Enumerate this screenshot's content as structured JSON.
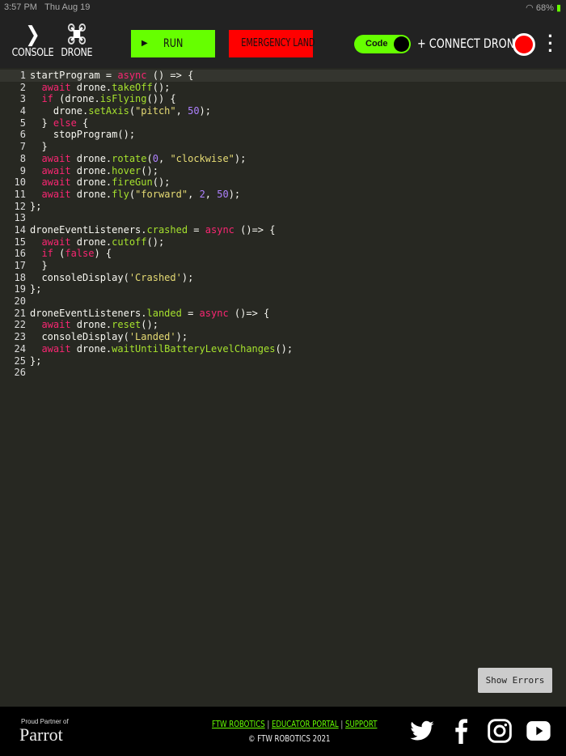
{
  "status": {
    "time": "3:57 PM",
    "date": "Thu Aug 19",
    "battery": "68%"
  },
  "toolbar": {
    "console": "CONSOLE",
    "drone": "DRONE",
    "run": "RUN",
    "emergency": "EMERGENCY LAND",
    "toggle": "Code",
    "connect": "+ CONNECT DRONE"
  },
  "editor": {
    "lines": [
      [
        [
          "c",
          "startProgram = "
        ],
        [
          "k",
          "async"
        ],
        [
          "c",
          " () => {"
        ]
      ],
      [
        [
          "c",
          "  "
        ],
        [
          "k",
          "await"
        ],
        [
          "c",
          " drone."
        ],
        [
          "f",
          "takeOff"
        ],
        [
          "c",
          "();"
        ]
      ],
      [
        [
          "c",
          "  "
        ],
        [
          "k",
          "if"
        ],
        [
          "c",
          " (drone."
        ],
        [
          "f",
          "isFlying"
        ],
        [
          "c",
          "()) {"
        ]
      ],
      [
        [
          "c",
          "    drone."
        ],
        [
          "f",
          "setAxis"
        ],
        [
          "c",
          "("
        ],
        [
          "s",
          "\"pitch\""
        ],
        [
          "c",
          ", "
        ],
        [
          "n",
          "50"
        ],
        [
          "c",
          ");"
        ]
      ],
      [
        [
          "c",
          "  } "
        ],
        [
          "k",
          "else"
        ],
        [
          "c",
          " {"
        ]
      ],
      [
        [
          "c",
          "    stopProgram();"
        ]
      ],
      [
        [
          "c",
          "  }"
        ]
      ],
      [
        [
          "c",
          "  "
        ],
        [
          "k",
          "await"
        ],
        [
          "c",
          " drone."
        ],
        [
          "f",
          "rotate"
        ],
        [
          "c",
          "("
        ],
        [
          "n",
          "0"
        ],
        [
          "c",
          ", "
        ],
        [
          "s",
          "\"clockwise\""
        ],
        [
          "c",
          ");"
        ]
      ],
      [
        [
          "c",
          "  "
        ],
        [
          "k",
          "await"
        ],
        [
          "c",
          " drone."
        ],
        [
          "f",
          "hover"
        ],
        [
          "c",
          "();"
        ]
      ],
      [
        [
          "c",
          "  "
        ],
        [
          "k",
          "await"
        ],
        [
          "c",
          " drone."
        ],
        [
          "f",
          "fireGun"
        ],
        [
          "c",
          "();"
        ]
      ],
      [
        [
          "c",
          "  "
        ],
        [
          "k",
          "await"
        ],
        [
          "c",
          " drone."
        ],
        [
          "f",
          "fly"
        ],
        [
          "c",
          "("
        ],
        [
          "s",
          "\"forward\""
        ],
        [
          "c",
          ", "
        ],
        [
          "n",
          "2"
        ],
        [
          "c",
          ", "
        ],
        [
          "n",
          "50"
        ],
        [
          "c",
          ");"
        ]
      ],
      [
        [
          "c",
          "};"
        ]
      ],
      [],
      [
        [
          "c",
          "droneEventListeners."
        ],
        [
          "f",
          "crashed"
        ],
        [
          "c",
          " = "
        ],
        [
          "k",
          "async"
        ],
        [
          "c",
          " ()=> {"
        ]
      ],
      [
        [
          "c",
          "  "
        ],
        [
          "k",
          "await"
        ],
        [
          "c",
          " drone."
        ],
        [
          "f",
          "cutoff"
        ],
        [
          "c",
          "();"
        ]
      ],
      [
        [
          "c",
          "  "
        ],
        [
          "k",
          "if"
        ],
        [
          "c",
          " ("
        ],
        [
          "k",
          "false"
        ],
        [
          "c",
          ") {"
        ]
      ],
      [
        [
          "c",
          "  }"
        ]
      ],
      [
        [
          "c",
          "  consoleDisplay("
        ],
        [
          "s",
          "'Crashed'"
        ],
        [
          "c",
          ");"
        ]
      ],
      [
        [
          "c",
          "};"
        ]
      ],
      [],
      [
        [
          "c",
          "droneEventListeners."
        ],
        [
          "f",
          "landed"
        ],
        [
          "c",
          " = "
        ],
        [
          "k",
          "async"
        ],
        [
          "c",
          " ()=> {"
        ]
      ],
      [
        [
          "c",
          "  "
        ],
        [
          "k",
          "await"
        ],
        [
          "c",
          " drone."
        ],
        [
          "f",
          "reset"
        ],
        [
          "c",
          "();"
        ]
      ],
      [
        [
          "c",
          "  consoleDisplay("
        ],
        [
          "s",
          "'Landed'"
        ],
        [
          "c",
          ");"
        ]
      ],
      [
        [
          "c",
          "  "
        ],
        [
          "k",
          "await"
        ],
        [
          "c",
          " drone."
        ],
        [
          "f",
          "waitUntilBatteryLevelChanges"
        ],
        [
          "c",
          "();"
        ]
      ],
      [
        [
          "c",
          "};"
        ]
      ],
      []
    ]
  },
  "show_errors": "Show Errors",
  "footer": {
    "partner": "Proud Partner of",
    "parrot": "Parrot",
    "link1": "FTW ROBOTICS",
    "link2": "EDUCATOR PORTAL",
    "link3": "SUPPORT",
    "sep": " | ",
    "copyright": "© FTW ROBOTICS 2021"
  },
  "colors": {
    "accent": "#66ff00",
    "danger": "#ff0000"
  }
}
